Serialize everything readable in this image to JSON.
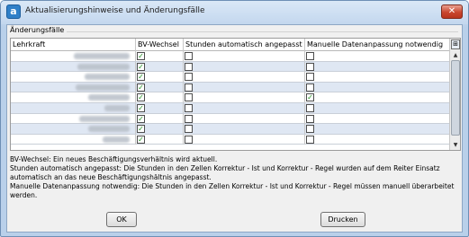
{
  "window": {
    "title": "Aktualisierungshinweise und Änderungsfälle",
    "close_glyph": "✕",
    "app_icon_glyph": "a"
  },
  "group": {
    "label": "Änderungsfälle"
  },
  "table": {
    "columns": [
      "Lehrkraft",
      "BV-Wechsel",
      "Stunden automatisch angepasst",
      "Manuelle Datenanpassung notwendig"
    ],
    "rows": [
      {
        "bv": true,
        "auto": false,
        "manual": false
      },
      {
        "bv": true,
        "auto": false,
        "manual": false
      },
      {
        "bv": true,
        "auto": false,
        "manual": false
      },
      {
        "bv": true,
        "auto": false,
        "manual": false
      },
      {
        "bv": true,
        "auto": false,
        "manual": true
      },
      {
        "bv": true,
        "auto": false,
        "manual": false
      },
      {
        "bv": true,
        "auto": false,
        "manual": false
      },
      {
        "bv": true,
        "auto": false,
        "manual": false
      },
      {
        "bv": true,
        "auto": false,
        "manual": false
      }
    ],
    "check_glyph": "✓",
    "config_glyph": "⊞",
    "scroll_up_glyph": "▲",
    "scroll_down_glyph": "▼"
  },
  "legend": {
    "bv": "BV-Wechsel: Ein neues Beschäftigungsverhältnis wird aktuell.",
    "auto": "Stunden automatisch angepasst: Die Stunden in den Zellen Korrektur - Ist und Korrektur - Regel wurden auf dem Reiter Einsatz automatisch an das neue Beschäftigungshältnis angepasst.",
    "manual": "Manuelle Datenanpassung notwendig: Die Stunden in den Zellen Korrektur - Ist und Korrektur - Regel müssen manuell überarbeitet werden."
  },
  "buttons": {
    "ok": "OK",
    "print": "Drucken"
  }
}
